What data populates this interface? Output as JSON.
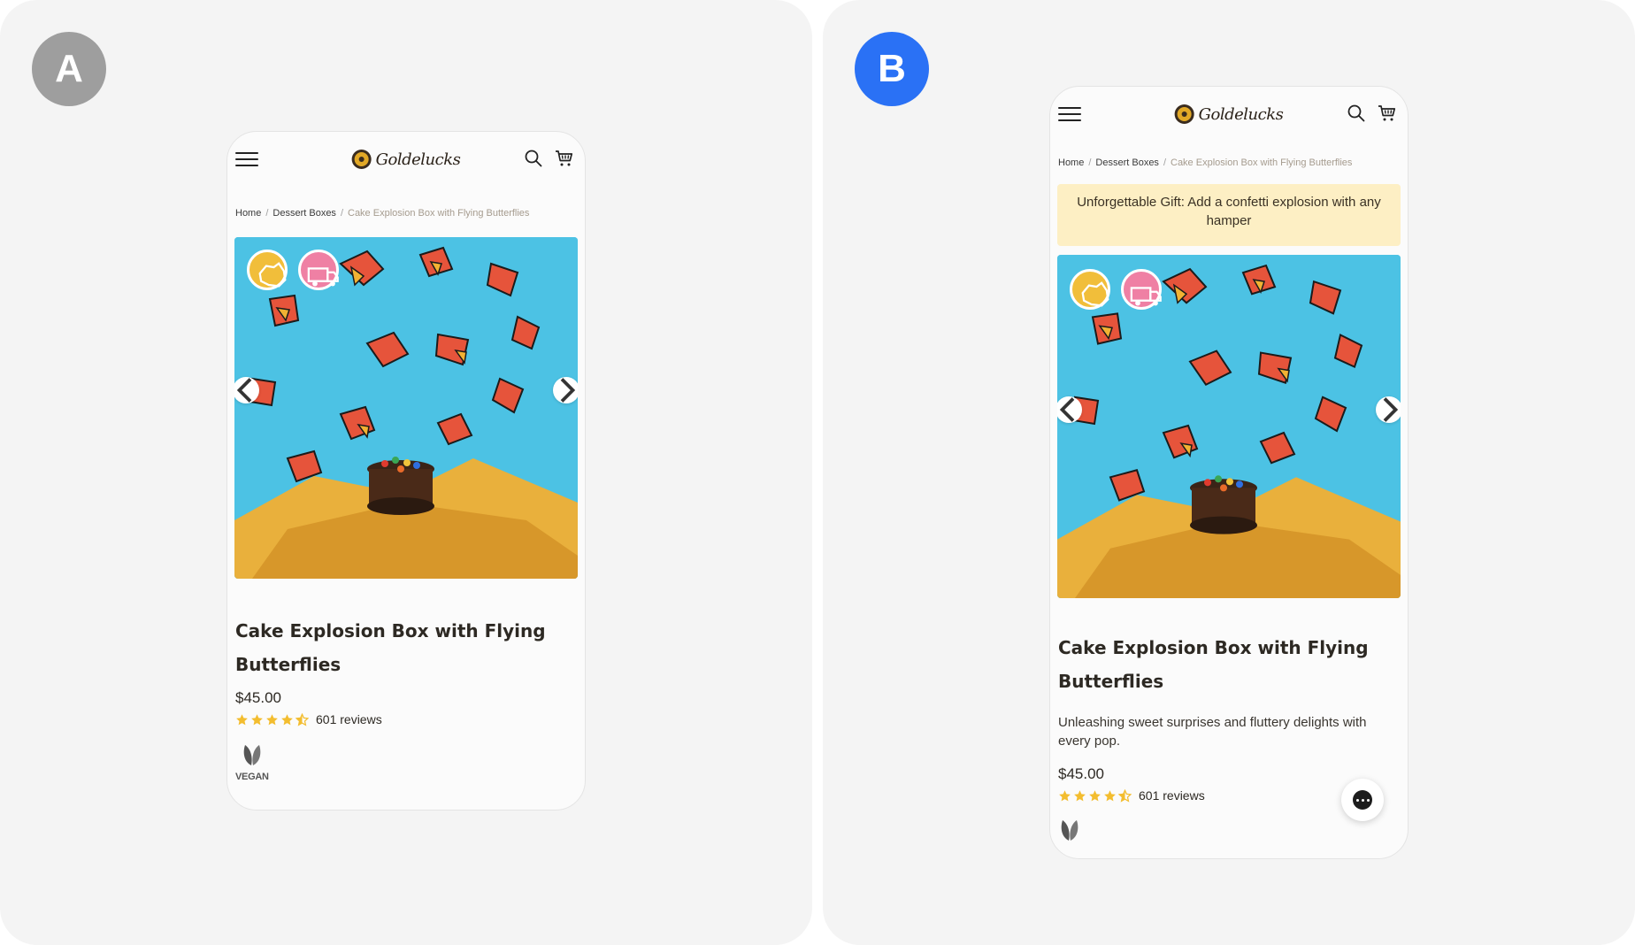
{
  "variants": {
    "a": {
      "badge": "A",
      "badge_color": "#9e9e9e"
    },
    "b": {
      "badge": "B",
      "badge_color": "#2a71f5"
    }
  },
  "brand": {
    "name": "Goldelucks"
  },
  "breadcrumb": {
    "home": "Home",
    "category": "Dessert Boxes",
    "current": "Cake Explosion Box with Flying Butterflies"
  },
  "promo": {
    "text": "Unforgettable Gift: Add a confetti explosion with any hamper"
  },
  "product": {
    "title": "Cake Explosion Box with Flying Butterflies",
    "description": "Unleashing sweet surprises and fluttery delights with every pop.",
    "price": "$45.00",
    "rating": 4.5,
    "reviews": "601 reviews",
    "diet_label": "VEGAN"
  },
  "colors": {
    "hero_bg": "#4cc2e4",
    "star": "#f3bd2f",
    "promo_bg": "#fdefc4"
  },
  "icons": [
    "hamburger-menu-icon",
    "search-icon",
    "cart-icon",
    "chevron-left-icon",
    "chevron-right-icon",
    "australia-map-icon",
    "delivery-truck-icon",
    "star-icon",
    "vegan-leaf-icon",
    "chat-icon"
  ]
}
